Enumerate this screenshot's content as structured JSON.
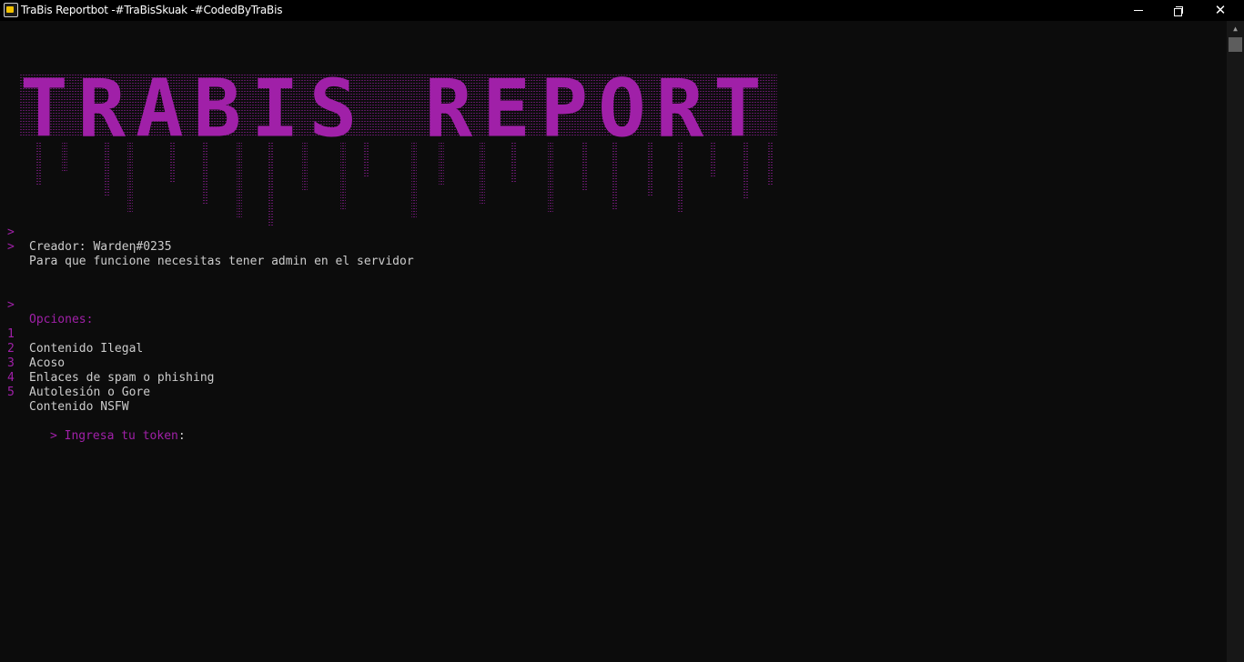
{
  "window": {
    "title": "TraBis Reportbot -#TraBisSkuak -#CodedByTraBis",
    "icon": "console-app-icon",
    "controls": {
      "minimize": "minimize-icon",
      "maximize": "restore-icon",
      "close": "✕"
    }
  },
  "banner": {
    "text": "TRABIS REPORT",
    "color": "#a020a8"
  },
  "info": [
    {
      "prompt": ">",
      "text": "Creador: Wardeη#0235"
    },
    {
      "prompt": ">",
      "text": "Para que funcione necesitas tener admin en el servidor"
    }
  ],
  "options": {
    "prompt": ">",
    "heading": "Opciones:",
    "items": [
      {
        "num": "1",
        "label": "Contenido Ilegal"
      },
      {
        "num": "2",
        "label": "Acoso"
      },
      {
        "num": "3",
        "label": "Enlaces de spam o phishing"
      },
      {
        "num": "4",
        "label": "Autolesión o Gore"
      },
      {
        "num": "5",
        "label": "Contenido NSFW"
      }
    ]
  },
  "input": {
    "prompt": "> Ingresa tu token",
    "colon": ":"
  },
  "colors": {
    "background": "#0c0c0c",
    "accent": "#a020a8",
    "text": "#cccccc"
  }
}
